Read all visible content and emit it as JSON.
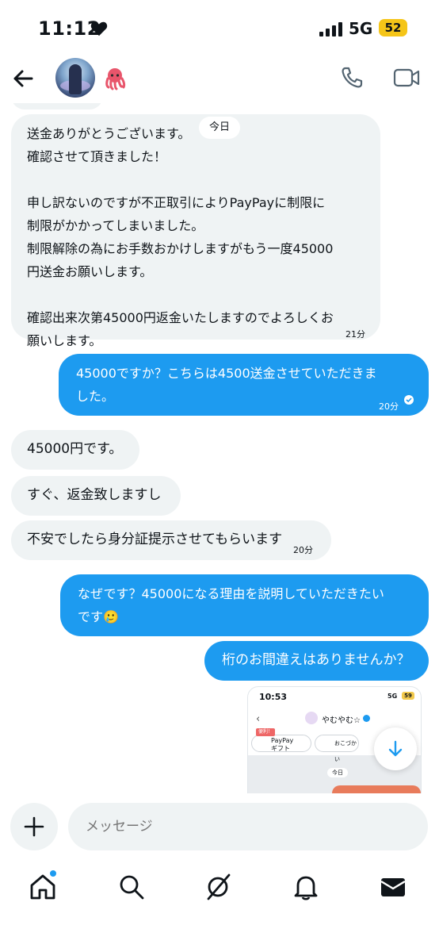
{
  "status_bar": {
    "time": "11:12",
    "network": "5G",
    "battery": "52",
    "battery_color": "#f5c518"
  },
  "header": {
    "back_icon": "arrow-left-icon",
    "avatar_icon": "avatar",
    "emoji": "octopus-emoji",
    "call_icon": "phone-icon",
    "video_icon": "video-icon"
  },
  "chat": {
    "date_label": "今日",
    "messages": [
      {
        "dir": "in",
        "text": "送金ありがとうございます。\n確認させて頂きました！\n\n申し訳ないのですが不正取引によりPayPayに制限に\n制限がかかってしまいました。\n制限解除の為にお手数おかけしますがもう一度45000\n円送金お願いします。\n\n確認出来次第45000円返金いたしますのでよろしくお\n願いします。",
        "time": "21分"
      },
      {
        "dir": "out",
        "text": "45000ですか？こちらは4500送金させていただきま\nした。",
        "time": "20分"
      },
      {
        "dir": "in",
        "text": "45000円です。"
      },
      {
        "dir": "in",
        "text": "すぐ、返金致しますし"
      },
      {
        "dir": "in",
        "text": "不安でしたら身分証提示させてもらいます",
        "time": "20分"
      },
      {
        "dir": "out",
        "text": "なぜです？45000になる理由を説明していただきたい\nです🥲"
      },
      {
        "dir": "out",
        "text": "桁のお間違えはありませんか？"
      }
    ],
    "attachment": {
      "time": "10:53",
      "network": "5G",
      "battery": "59",
      "contact_name": "やむやむ☆",
      "badge": "便利！",
      "pill1": "PayPay\nギフト",
      "pill2": "おこづかい",
      "date_label": "今日"
    }
  },
  "composer": {
    "placeholder": "メッセージ",
    "plus_icon": "plus-icon"
  },
  "bottom_nav": {
    "items": [
      "home-icon",
      "search-icon",
      "grok-icon",
      "bell-icon",
      "mail-icon"
    ]
  },
  "colors": {
    "accent": "#1d9bf0",
    "incoming_bg": "#eff3f4",
    "text": "#0f1419"
  }
}
